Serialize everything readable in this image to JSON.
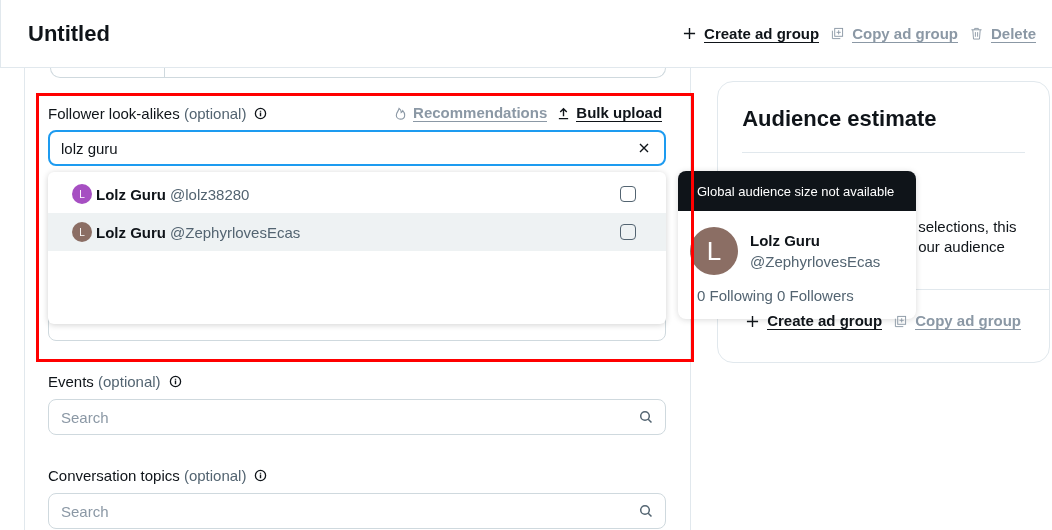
{
  "header": {
    "title": "Untitled",
    "actions": [
      {
        "label": "Create ad group",
        "disabled": false,
        "kind": "plus"
      },
      {
        "label": "Copy ad group",
        "disabled": true,
        "kind": "copy"
      },
      {
        "label": "Delete",
        "disabled": true,
        "kind": "trash"
      }
    ]
  },
  "follower_lookalikes": {
    "label": "Follower look-alikes",
    "optional": "(optional)",
    "links": [
      {
        "label": "Recommendations",
        "disabled": true,
        "kind": "flame"
      },
      {
        "label": "Bulk upload",
        "disabled": false,
        "kind": "upload"
      }
    ],
    "value": "lolz guru",
    "results": [
      {
        "name": "Lolz Guru",
        "handle": "@lolz38280",
        "initial": "L",
        "color": "#a64fc2",
        "checked": false,
        "hovered": false
      },
      {
        "name": "Lolz Guru",
        "handle": "@ZephyrlovesEcas",
        "initial": "L",
        "color": "#8b6e64",
        "checked": false,
        "hovered": true
      }
    ]
  },
  "fields": [
    {
      "label": "Events",
      "optional": "(optional)",
      "placeholder": "Search"
    },
    {
      "label": "Conversation topics",
      "optional": "(optional)",
      "placeholder": "Search"
    }
  ],
  "audience_estimate": {
    "title": "Audience estimate",
    "text_lines": [
      "selections, this",
      "our audience"
    ],
    "actions": [
      {
        "label": "Create ad group",
        "disabled": false,
        "kind": "plus"
      },
      {
        "label": "Copy ad group",
        "disabled": true,
        "kind": "copy"
      }
    ]
  },
  "tooltip": {
    "header": "Global audience size not available",
    "name": "Lolz Guru",
    "handle": "@ZephyrlovesEcas",
    "initial": "L",
    "color": "#8b6e64",
    "stats": "0 Following 0 Followers"
  }
}
